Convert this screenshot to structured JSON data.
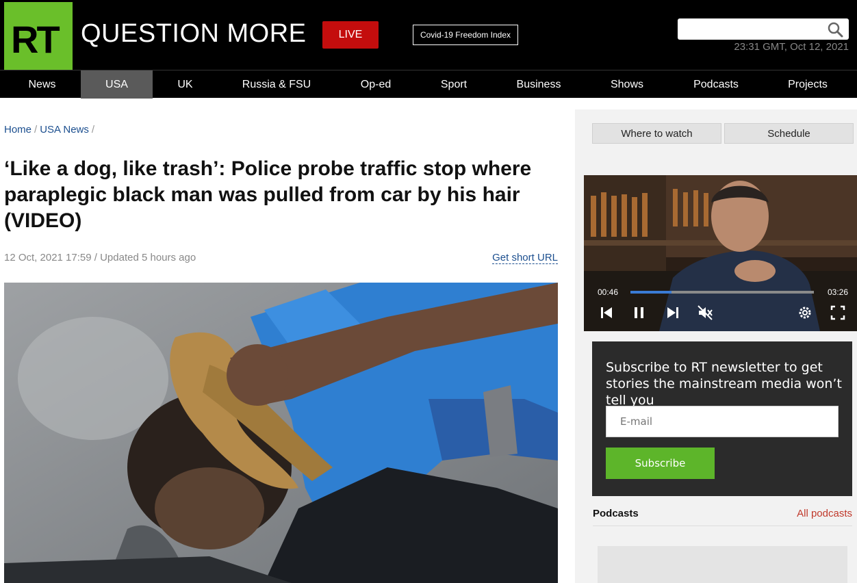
{
  "header": {
    "logo_text": "RT",
    "brand": "QUESTION MORE",
    "live_label": "LIVE",
    "covid_label": "Covid-19 Freedom Index",
    "search_placeholder": "",
    "datetime": "23:31 GMT, Oct 12, 2021"
  },
  "nav": {
    "items": [
      {
        "label": "News"
      },
      {
        "label": "USA"
      },
      {
        "label": "UK"
      },
      {
        "label": "Russia & FSU"
      },
      {
        "label": "Op-ed"
      },
      {
        "label": "Sport"
      },
      {
        "label": "Business"
      },
      {
        "label": "Shows"
      },
      {
        "label": "Podcasts"
      },
      {
        "label": "Projects"
      }
    ],
    "active": "USA"
  },
  "breadcrumb": {
    "home": "Home",
    "section": "USA News"
  },
  "article": {
    "headline": "‘Like a dog, like trash’: Police probe traffic stop where paraplegic black man was pulled from car by his hair (VIDEO)",
    "meta": "12 Oct, 2021 17:59 / Updated 5 hours ago",
    "short_url": "Get short URL"
  },
  "sidebar": {
    "where_to_watch": "Where to watch",
    "schedule": "Schedule",
    "video": {
      "current": "00:46",
      "duration": "03:26",
      "progress": 0.223
    },
    "newsletter": {
      "text": "Subscribe to RT newsletter to get stories the mainstream media won’t tell you",
      "email_placeholder": "E-mail",
      "subscribe_label": "Subscribe"
    },
    "podcasts": {
      "title": "Podcasts",
      "all_link": "All podcasts"
    }
  },
  "colors": {
    "brand_green": "#6abf2a",
    "live_red": "#c40d0d",
    "link_blue": "#1c4f8f",
    "subscribe_green": "#5db52a",
    "podcast_link_red": "#c0392b"
  }
}
